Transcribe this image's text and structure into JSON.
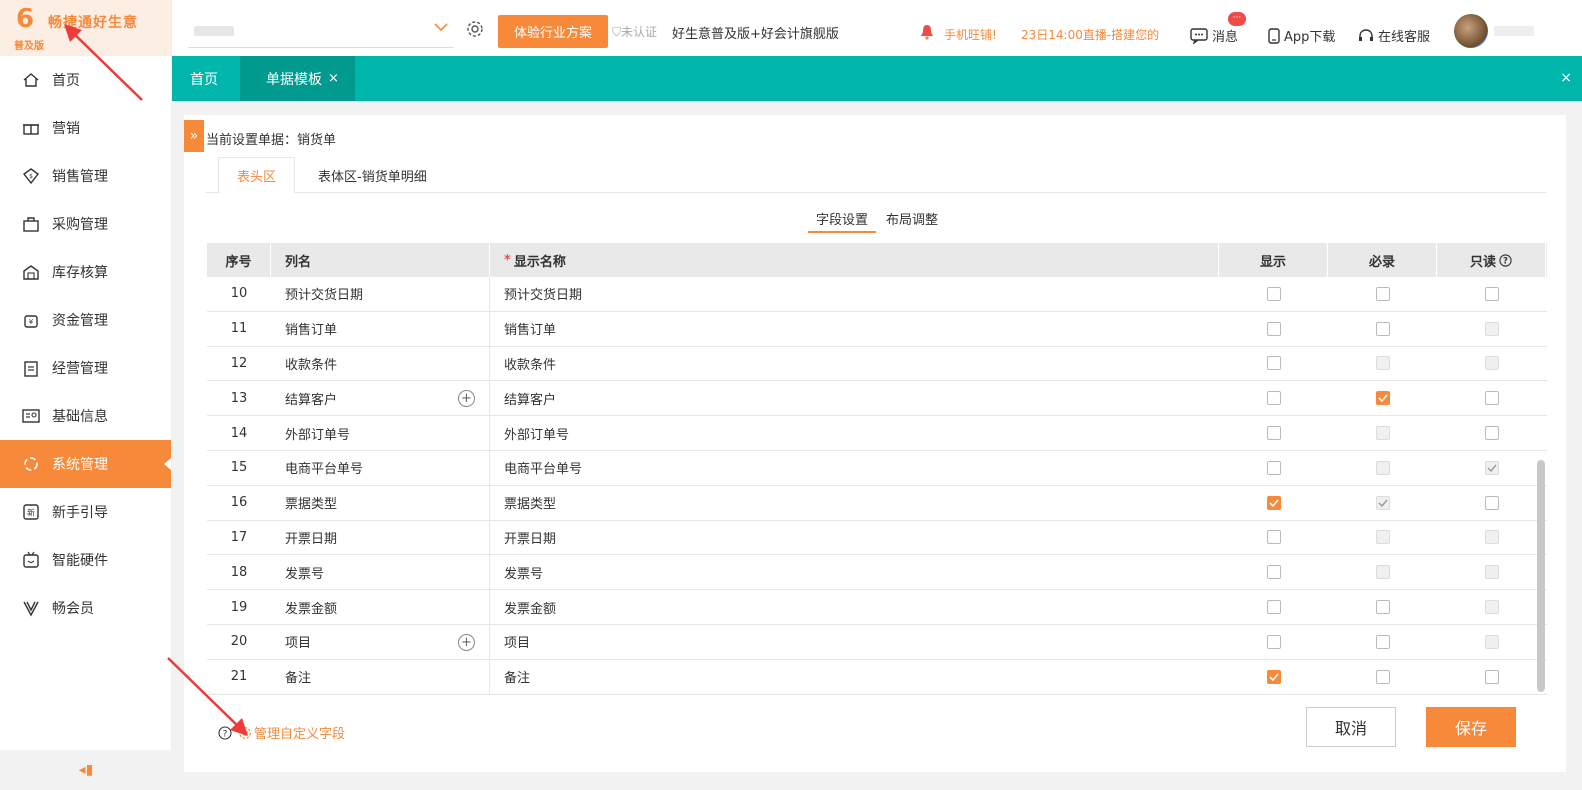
{
  "brand": {
    "name": "畅捷通好生意",
    "edition": "普及版",
    "logo_mark": "6"
  },
  "sidebar": {
    "items": [
      {
        "label": "首页",
        "icon": "home-icon"
      },
      {
        "label": "营销",
        "icon": "gift-icon"
      },
      {
        "label": "销售管理",
        "icon": "sales-icon"
      },
      {
        "label": "采购管理",
        "icon": "bag-icon"
      },
      {
        "label": "库存核算",
        "icon": "warehouse-icon"
      },
      {
        "label": "资金管理",
        "icon": "money-icon"
      },
      {
        "label": "经营管理",
        "icon": "clipboard-icon"
      },
      {
        "label": "基础信息",
        "icon": "id-card-icon"
      },
      {
        "label": "系统管理",
        "icon": "system-icon",
        "active": true
      },
      {
        "label": "新手引导",
        "icon": "new-icon"
      },
      {
        "label": "智能硬件",
        "icon": "hardware-icon"
      },
      {
        "label": "畅会员",
        "icon": "vip-icon"
      }
    ],
    "collapse_label": "◂▮"
  },
  "header": {
    "trial_button": "体验行业方案",
    "cert_status": "未认证",
    "version": "好生意普及版+好会计旗舰版",
    "promo1": "手机旺铺!",
    "promo2": "23日14:00直播-搭建您的",
    "messages": "消息",
    "message_badge": "···",
    "app_download": "App下载",
    "online_service": "在线客服"
  },
  "tabs": {
    "home": "首页",
    "current": "单据模板",
    "close": "×",
    "close_all": "×"
  },
  "page": {
    "current_doc": "当前设置单据：销货单",
    "subtabs": [
      "表头区",
      "表体区-销货单明细"
    ],
    "setting_tabs": [
      "字段设置",
      "布局调整"
    ]
  },
  "table": {
    "headers": {
      "no": "序号",
      "name": "列名",
      "display": "显示名称",
      "show": "显示",
      "required": "必录",
      "readonly": "只读"
    },
    "rows": [
      {
        "no": "10",
        "name": "预计交货日期",
        "display": "预计交货日期",
        "plus": false,
        "show": "off",
        "req": "off",
        "ro": "off"
      },
      {
        "no": "11",
        "name": "销售订单",
        "display": "销售订单",
        "plus": false,
        "show": "off",
        "req": "off",
        "ro": "dis"
      },
      {
        "no": "12",
        "name": "收款条件",
        "display": "收款条件",
        "plus": false,
        "show": "off",
        "req": "dis",
        "ro": "dis"
      },
      {
        "no": "13",
        "name": "结算客户",
        "display": "结算客户",
        "plus": true,
        "show": "off",
        "req": "on",
        "ro": "off"
      },
      {
        "no": "14",
        "name": "外部订单号",
        "display": "外部订单号",
        "plus": false,
        "show": "off",
        "req": "dis",
        "ro": "off"
      },
      {
        "no": "15",
        "name": "电商平台单号",
        "display": "电商平台单号",
        "plus": false,
        "show": "off",
        "req": "dis",
        "ro": "dis-on"
      },
      {
        "no": "16",
        "name": "票据类型",
        "display": "票据类型",
        "plus": false,
        "show": "on",
        "req": "dis-on",
        "ro": "off"
      },
      {
        "no": "17",
        "name": "开票日期",
        "display": "开票日期",
        "plus": false,
        "show": "off",
        "req": "dis",
        "ro": "dis"
      },
      {
        "no": "18",
        "name": "发票号",
        "display": "发票号",
        "plus": false,
        "show": "off",
        "req": "dis",
        "ro": "dis"
      },
      {
        "no": "19",
        "name": "发票金额",
        "display": "发票金额",
        "plus": false,
        "show": "off",
        "req": "off",
        "ro": "dis"
      },
      {
        "no": "20",
        "name": "项目",
        "display": "项目",
        "plus": true,
        "show": "off",
        "req": "off",
        "ro": "dis"
      },
      {
        "no": "21",
        "name": "备注",
        "display": "备注",
        "plus": false,
        "show": "on",
        "req": "off",
        "ro": "off"
      }
    ]
  },
  "footer": {
    "manage_fields": "管理自定义字段",
    "cancel": "取消",
    "save": "保存"
  },
  "colors": {
    "accent": "#f7893b",
    "teal": "#00b5a9",
    "teal_dark": "#009a8f",
    "arrow": "#ef3a3a"
  }
}
